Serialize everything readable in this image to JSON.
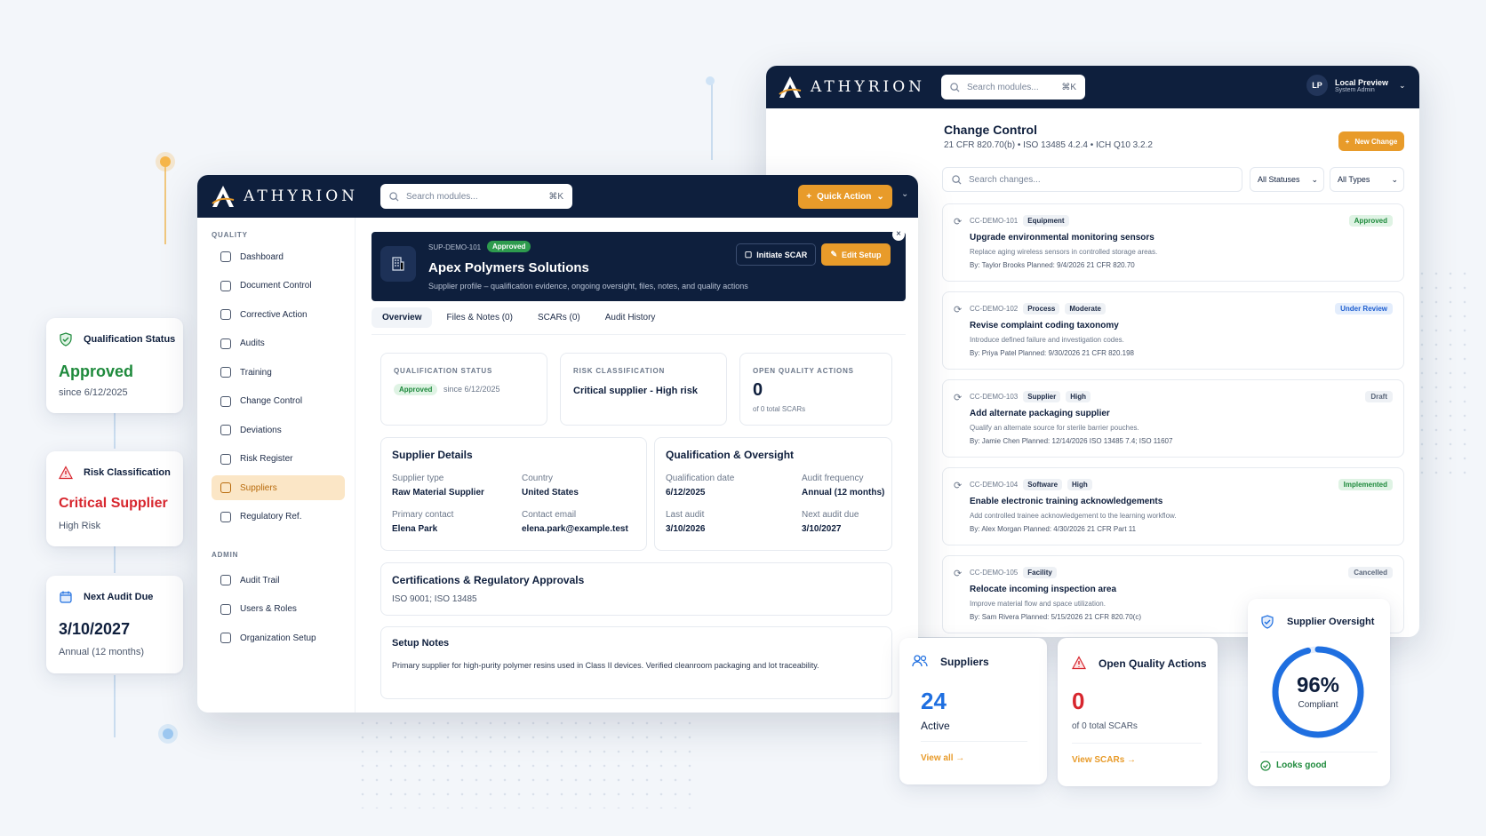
{
  "brand": {
    "name": "ATHYRION",
    "gold": "#e89b2a",
    "navy": "#0e1f3d",
    "green": "#1e8a3c",
    "red": "#d7262e",
    "blue": "#1f6fe0"
  },
  "left_cards": {
    "qualification": {
      "title": "Qualification Status",
      "value": "Approved",
      "since": "since 6/12/2025",
      "icon": "shield-check-icon"
    },
    "risk": {
      "title": "Risk Classification",
      "value": "Critical Supplier",
      "sub": "High Risk",
      "icon": "warning-triangle-icon"
    },
    "audit": {
      "title": "Next Audit Due",
      "value": "3/10/2027",
      "sub": "Annual (12 months)",
      "icon": "calendar-icon"
    }
  },
  "main_window": {
    "search_placeholder": "Search modules...",
    "search_kbd": "⌘K",
    "quick_action": "Quick Action",
    "sidebar": {
      "section_quality": "QUALITY",
      "section_admin": "ADMIN",
      "items": [
        "Dashboard",
        "Document Control",
        "Corrective Action",
        "Audits",
        "Training",
        "Change Control",
        "Deviations",
        "Risk Register",
        "Suppliers",
        "Regulatory Ref."
      ],
      "admin_items": [
        "Audit Trail",
        "Users & Roles",
        "Organization Setup"
      ]
    },
    "header": {
      "id": "SUP-DEMO-101",
      "status": "Approved",
      "name": "Apex Polymers Solutions",
      "subtitle": "Supplier profile – qualification evidence, ongoing oversight, files, notes, and quality actions",
      "btn_scar": "Initiate SCAR",
      "btn_edit": "Edit Setup"
    },
    "tabs": [
      "Overview",
      "Files & Notes (0)",
      "SCARs (0)",
      "Audit History"
    ],
    "summary": {
      "qual_label": "QUALIFICATION STATUS",
      "qual_pill": "Approved",
      "qual_since": "since 6/12/2025",
      "risk_label": "RISK CLASSIFICATION",
      "risk_value": "Critical supplier - High risk",
      "oqa_label": "OPEN QUALITY ACTIONS",
      "oqa_value": "0",
      "oqa_sub": "of 0 total SCARs"
    },
    "supplier_details": {
      "title": "Supplier Details",
      "type_k": "Supplier type",
      "type_v": "Raw Material Supplier",
      "country_k": "Country",
      "country_v": "United States",
      "contact_k": "Primary contact",
      "contact_v": "Elena Park",
      "email_k": "Contact email",
      "email_v": "elena.park@example.test"
    },
    "qualification_oversight": {
      "title": "Qualification & Oversight",
      "qdate_k": "Qualification date",
      "qdate_v": "6/12/2025",
      "freq_k": "Audit frequency",
      "freq_v": "Annual (12 months)",
      "last_k": "Last audit",
      "last_v": "3/10/2026",
      "next_k": "Next audit due",
      "next_v": "3/10/2027"
    },
    "certifications": {
      "title": "Certifications & Regulatory Approvals",
      "value": "ISO 9001; ISO 13485"
    },
    "setup_notes": {
      "title": "Setup Notes",
      "value": "Primary supplier for high-purity polymer resins used in Class II devices. Verified cleanroom packaging and lot traceability."
    }
  },
  "cc_window": {
    "search_placeholder": "Search modules...",
    "search_kbd": "⌘K",
    "user_initials": "LP",
    "user_name": "Local Preview",
    "user_role": "System Admin",
    "title": "Change Control",
    "subtitle": "21 CFR 820.70(b) • ISO 13485 4.2.4 • ICH Q10 3.2.2",
    "new_change": "New Change",
    "filter_search": "Search changes...",
    "filter_status": "All Statuses",
    "filter_type": "All Types",
    "items": [
      {
        "id": "CC-DEMO-101",
        "tags": [
          "Equipment"
        ],
        "title": "Upgrade environmental monitoring sensors",
        "desc": "Replace aging wireless sensors in controlled storage areas.",
        "meta": "By: Taylor Brooks   Planned: 9/4/2026   21 CFR 820.70",
        "status": "Approved",
        "status_color": "#1e8a3c",
        "status_bg": "#dff3e4"
      },
      {
        "id": "CC-DEMO-102",
        "tags": [
          "Process",
          "Moderate"
        ],
        "title": "Revise complaint coding taxonomy",
        "desc": "Introduce defined failure and investigation codes.",
        "meta": "By: Priya Patel   Planned: 9/30/2026   21 CFR 820.198",
        "status": "Under Review",
        "status_color": "#1f5fd0",
        "status_bg": "#e3edfc"
      },
      {
        "id": "CC-DEMO-103",
        "tags": [
          "Supplier",
          "High"
        ],
        "title": "Add alternate packaging supplier",
        "desc": "Qualify an alternate source for sterile barrier pouches.",
        "meta": "By: Jamie Chen   Planned: 12/14/2026   ISO 13485 7.4; ISO 11607",
        "status": "Draft",
        "status_color": "#5a667a",
        "status_bg": "#eef1f5"
      },
      {
        "id": "CC-DEMO-104",
        "tags": [
          "Software",
          "High"
        ],
        "title": "Enable electronic training acknowledgements",
        "desc": "Add controlled trainee acknowledgement to the learning workflow.",
        "meta": "By: Alex Morgan   Planned: 4/30/2026   21 CFR Part 11",
        "status": "Implemented",
        "status_color": "#1e8a3c",
        "status_bg": "#dff3e4"
      },
      {
        "id": "CC-DEMO-105",
        "tags": [
          "Facility"
        ],
        "title": "Relocate incoming inspection area",
        "desc": "Improve material flow and space utilization.",
        "meta": "By: Sam Rivera   Planned: 5/15/2026   21 CFR 820.70(c)",
        "status": "Cancelled",
        "status_color": "#5a667a",
        "status_bg": "#eef1f5"
      }
    ]
  },
  "bottom_cards": {
    "suppliers": {
      "title": "Suppliers",
      "value": "24",
      "sub": "Active",
      "link": "View all →"
    },
    "oqa": {
      "title": "Open Quality Actions",
      "value": "0",
      "sub": "of 0 total SCARs",
      "link": "View SCARs →"
    },
    "oversight": {
      "title": "Supplier Oversight",
      "value": "96%",
      "sub": "Compliant",
      "footer": "Looks good",
      "percent": 96
    }
  }
}
